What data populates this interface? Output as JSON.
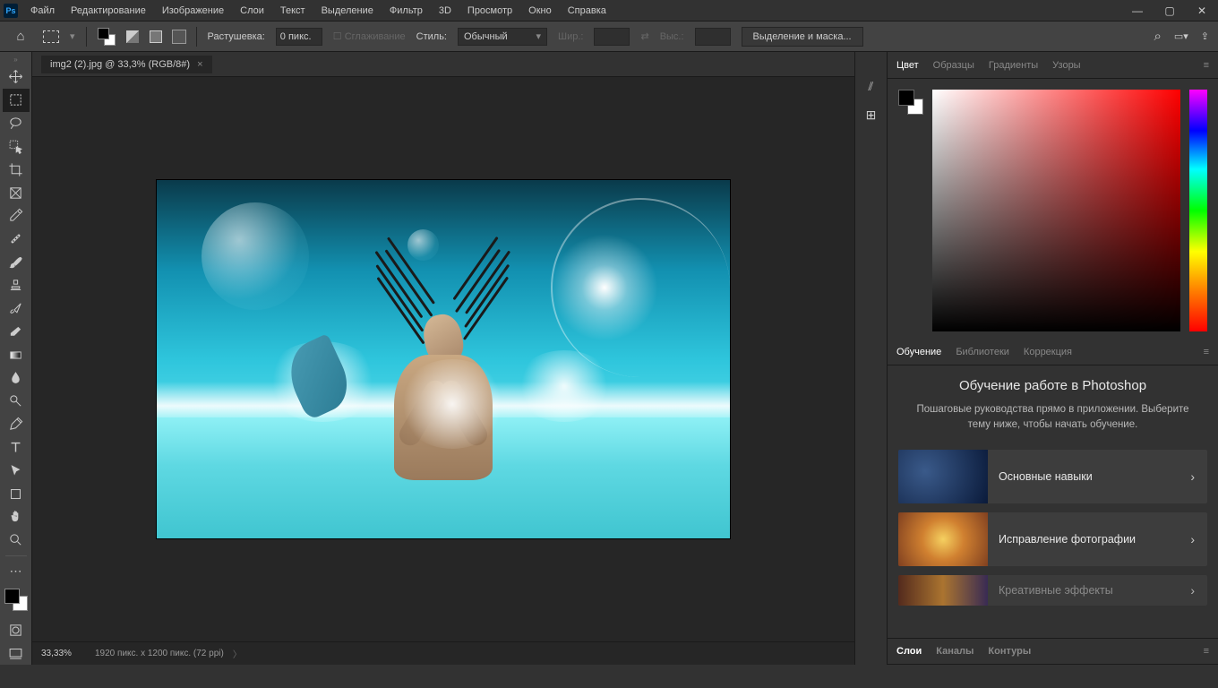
{
  "menu": [
    "Файл",
    "Редактирование",
    "Изображение",
    "Слои",
    "Текст",
    "Выделение",
    "Фильтр",
    "3D",
    "Просмотр",
    "Окно",
    "Справка"
  ],
  "options": {
    "feather_label": "Растушевка:",
    "feather_value": "0 пикс.",
    "antialias": "Сглаживание",
    "style_label": "Стиль:",
    "style_value": "Обычный",
    "width_label": "Шир.:",
    "height_label": "Выс.:",
    "mask_btn": "Выделение и маска..."
  },
  "doc_tab": "img2 (2).jpg @ 33,3% (RGB/8#)",
  "status": {
    "zoom": "33,33%",
    "dims": "1920 пикс. x 1200 пикс. (72 ppi)"
  },
  "color_tabs": [
    "Цвет",
    "Образцы",
    "Градиенты",
    "Узоры"
  ],
  "learn_tabs": [
    "Обучение",
    "Библиотеки",
    "Коррекция"
  ],
  "learn": {
    "title": "Обучение работе в Photoshop",
    "subtitle": "Пошаговые руководства прямо в приложении. Выберите тему ниже, чтобы начать обучение.",
    "cards": [
      "Основные навыки",
      "Исправление фотографии",
      "Креативные эффекты"
    ]
  },
  "bottom_tabs": [
    "Слои",
    "Каналы",
    "Контуры"
  ]
}
